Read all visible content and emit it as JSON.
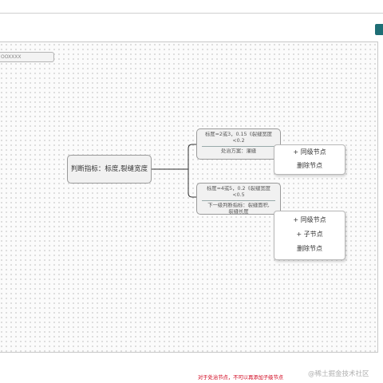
{
  "search": {
    "placeholder": "OOXXXX"
  },
  "root_node": {
    "label": "判断指标：标度,裂缝宽度"
  },
  "children": [
    {
      "condition_line1": "标度=2或3，0.15《裂缝宽度",
      "condition_line2": "<0.2",
      "detail_line1": "处治方案：灌缝",
      "detail_line2": ""
    },
    {
      "condition_line1": "标度=4或5，0.2《裂缝宽度",
      "condition_line2": "<0.5",
      "detail_line1": "下一级判断指标：裂缝面积,",
      "detail_line2": "裂缝长度"
    }
  ],
  "context_menu_leaf": {
    "add_sibling": "+ 同级节点",
    "delete": "删除节点"
  },
  "context_menu_branch": {
    "add_sibling": "+ 同级节点",
    "add_child": "+ 子节点",
    "delete": "删除节点"
  },
  "footer_note": "对于处治节点，不可以再添加子级节点",
  "watermark": "@稀土掘金技术社区",
  "colors": {
    "header_button": "#1e6e75",
    "footer_note": "#d0021b"
  }
}
